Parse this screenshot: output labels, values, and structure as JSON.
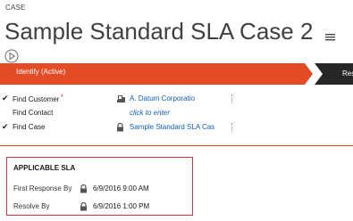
{
  "header": {
    "entity_label": "CASE",
    "title": "Sample Standard SLA Case 2"
  },
  "process": {
    "active_stage": "Identify (Active)",
    "next_stage": "Res",
    "colors": {
      "active": "#e34c25",
      "inactive": "#262626"
    }
  },
  "fields": [
    {
      "checked": true,
      "label": "Find Customer",
      "required": true,
      "icon": "account-icon",
      "value": "A. Datum Corporatio"
    },
    {
      "checked": false,
      "label": "Find Contact",
      "required": false,
      "icon": "",
      "value": "click to enter"
    },
    {
      "checked": true,
      "label": "Find Case",
      "required": false,
      "icon": "lock-icon",
      "value": "Sample Standard SLA Cas"
    }
  ],
  "sla": {
    "title": "APPLICABLE SLA",
    "rows": [
      {
        "label": "First Response By",
        "icon": "lock-icon",
        "value": "6/9/2016   9:00 AM"
      },
      {
        "label": "Resolve By",
        "icon": "lock-icon",
        "value": "6/9/2016   1:00 PM"
      }
    ]
  }
}
